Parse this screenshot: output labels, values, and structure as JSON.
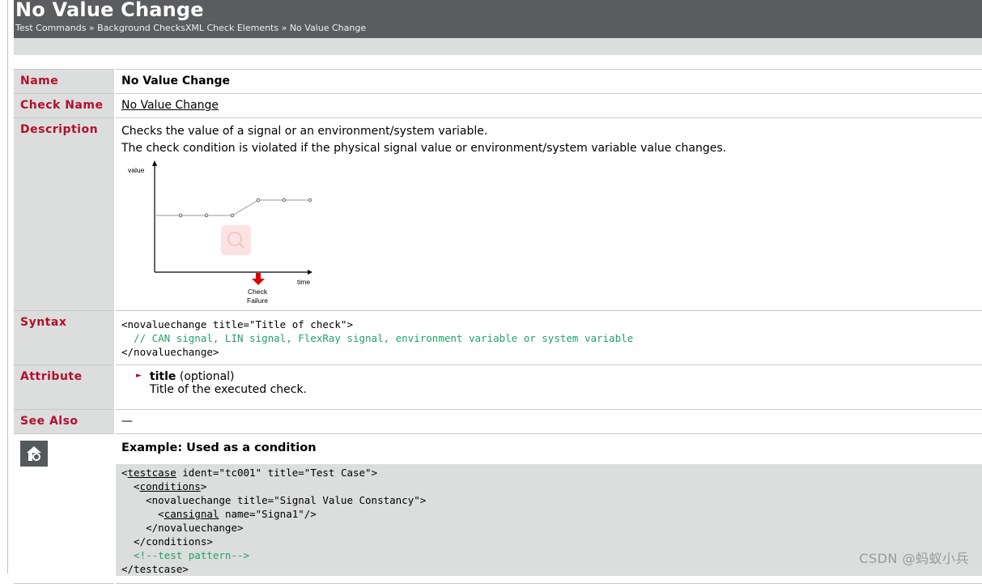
{
  "header": {
    "title": "No Value Change",
    "breadcrumb": "Test Commands » Background ChecksXML Check Elements » No Value Change"
  },
  "rows": {
    "name": {
      "label": "Name",
      "value": "No Value Change"
    },
    "check_name": {
      "label": "Check Name",
      "value": "No Value Change"
    },
    "description": {
      "label": "Description",
      "lines": [
        "Checks the value of a signal or an environment/system variable.",
        "The check condition is violated if the physical signal value or environment/system variable value changes."
      ],
      "figure": {
        "y_label": "value",
        "x_label": "time",
        "marker_label_1": "Check",
        "marker_label_2": "Failure",
        "marker_color": "#e00000"
      }
    },
    "syntax": {
      "label": "Syntax",
      "line1": "<novaluechange title=\"Title of check\">",
      "line2": "  // CAN signal, LIN signal, FlexRay signal, environment variable or system variable",
      "line3": "</novaluechange>"
    },
    "attribute": {
      "label": "Attribute",
      "name": "title",
      "qualifier": " (optional)",
      "desc": "Title of the executed check."
    },
    "see_also": {
      "label": "See Also",
      "value": "—"
    },
    "example": {
      "icon": "example-icon",
      "title": "Example: Used as a condition",
      "code": {
        "l1_tag": "testcase",
        "l1_rest": " ident=\"tc001\" title=\"Test Case\">",
        "l2_tag": "conditions",
        "l3": "    <novaluechange title=\"Signal Value Constancy\">",
        "l4_tag": "cansignal",
        "l4_rest": " name=\"Signa1\"/>",
        "l5": "    </novaluechange>",
        "l6": "  </conditions>",
        "l7": "  <!--test pattern-->",
        "l8": "</testcase>"
      }
    }
  },
  "watermark": "CSDN @蚂蚁小兵",
  "colors": {
    "label_red": "#b0102c",
    "code_green": "#22a06b",
    "header_bg": "#5a5c5e"
  }
}
